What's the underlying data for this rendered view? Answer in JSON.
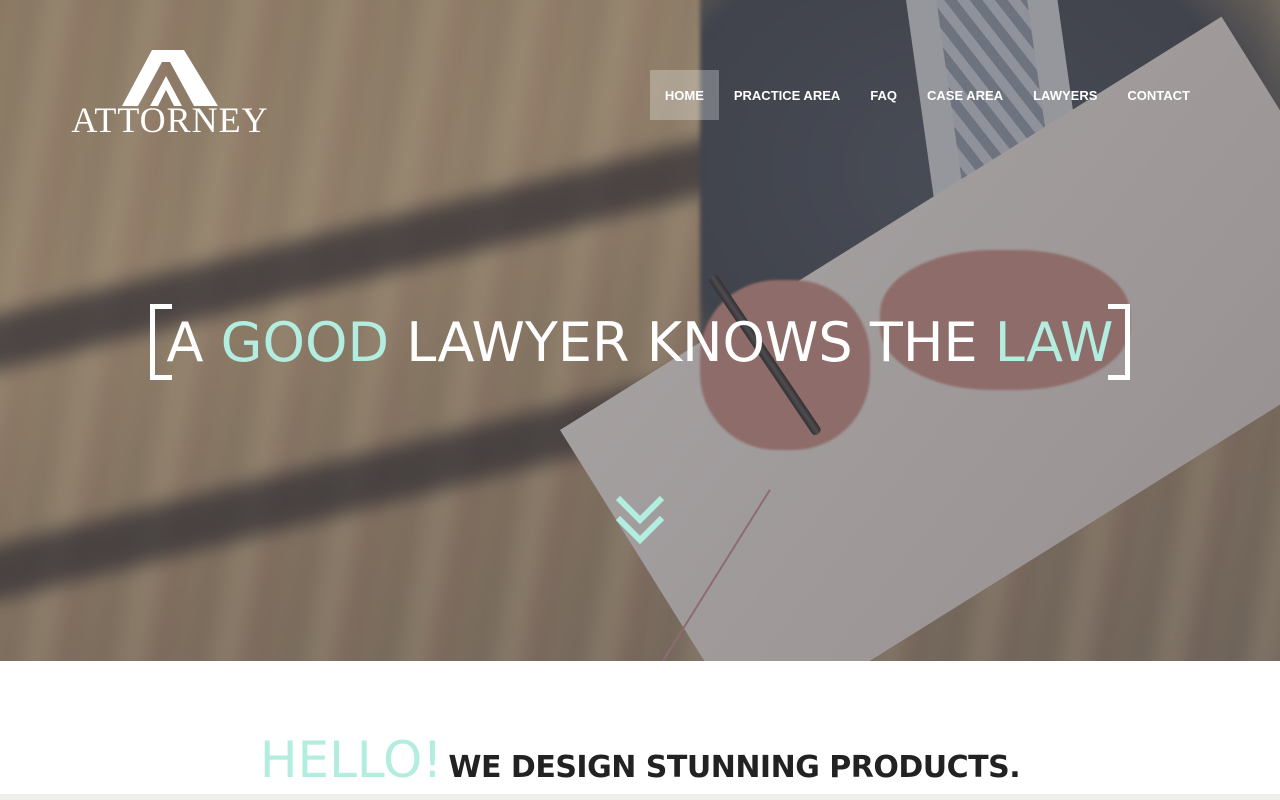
{
  "brand": {
    "logo_text": "ATTORNEY",
    "logo_icon": "roof-chevron-logo-icon"
  },
  "nav": {
    "items": [
      {
        "label": "HOME",
        "active": true
      },
      {
        "label": "PRACTICE AREA",
        "active": false
      },
      {
        "label": "FAQ",
        "active": false
      },
      {
        "label": "CASE AREA",
        "active": false
      },
      {
        "label": "LAWYERS",
        "active": false
      },
      {
        "label": "CONTACT",
        "active": false
      }
    ]
  },
  "hero": {
    "headline": {
      "part1": "A ",
      "accent1": "GOOD",
      "part2": " LAWYER KNOWS THE ",
      "accent2": "LAW"
    },
    "scroll_icon": "double-chevron-down-icon"
  },
  "intro": {
    "hello": "HELLO!",
    "tagline": "WE DESIGN STUNNING PRODUCTS."
  },
  "colors": {
    "accent": "#b2ede0",
    "text_dark": "#222222",
    "nav_text": "#ffffff"
  }
}
